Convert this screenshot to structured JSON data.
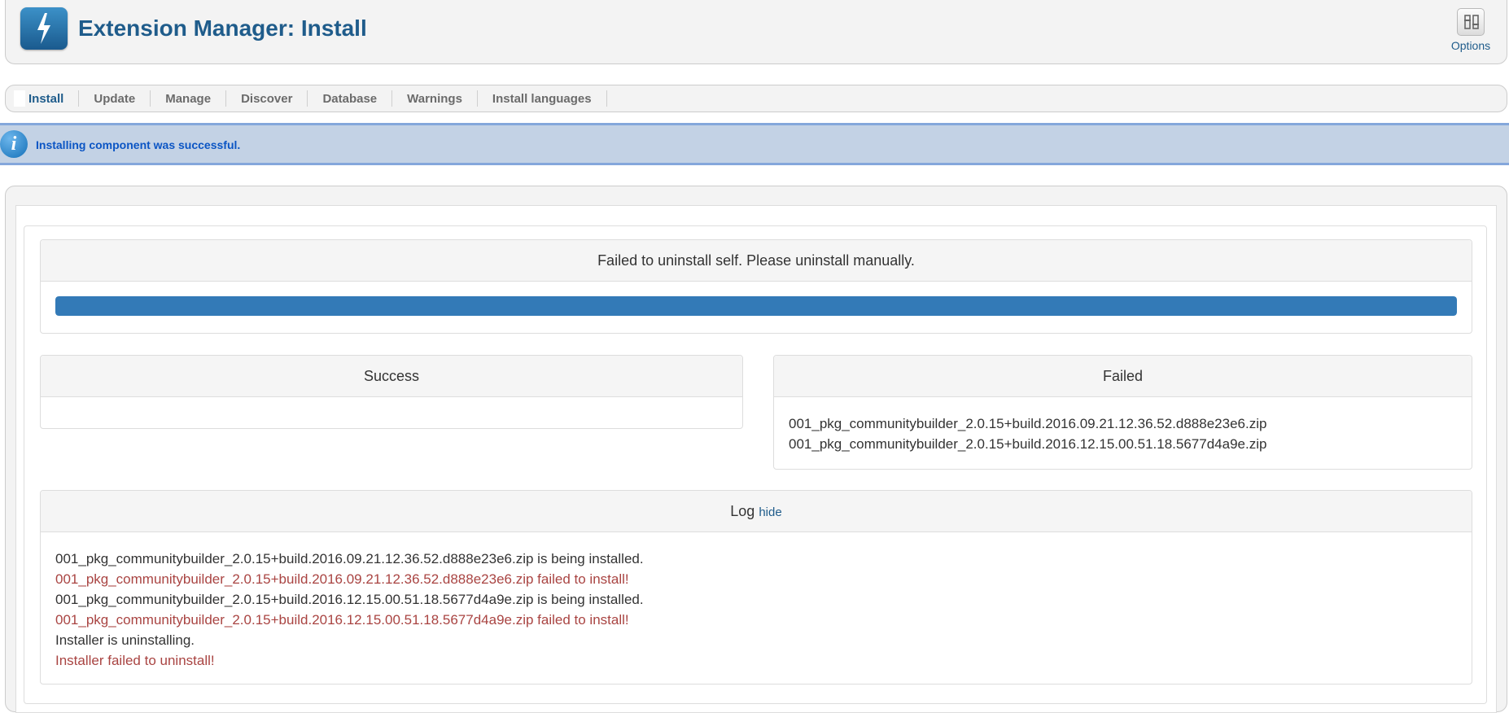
{
  "header": {
    "title": "Extension Manager: Install",
    "options_label": "Options"
  },
  "subnav": {
    "items": [
      "Install",
      "Update",
      "Manage",
      "Discover",
      "Database",
      "Warnings",
      "Install languages"
    ],
    "active": "Install"
  },
  "message": {
    "text": "Installing component was successful."
  },
  "status_panel": {
    "heading": "Failed to uninstall self. Please uninstall manually.",
    "progress": 1.0
  },
  "success_panel": {
    "heading": "Success",
    "items": []
  },
  "failed_panel": {
    "heading": "Failed",
    "items": [
      "001_pkg_communitybuilder_2.0.15+build.2016.09.21.12.36.52.d888e23e6.zip",
      "001_pkg_communitybuilder_2.0.15+build.2016.12.15.00.51.18.5677d4a9e.zip"
    ]
  },
  "log_panel": {
    "heading": "Log",
    "hide_label": "hide",
    "lines": [
      {
        "text": "001_pkg_communitybuilder_2.0.15+build.2016.09.21.12.36.52.d888e23e6.zip is being installed.",
        "status": "info"
      },
      {
        "text": "001_pkg_communitybuilder_2.0.15+build.2016.09.21.12.36.52.d888e23e6.zip failed to install!",
        "status": "error"
      },
      {
        "text": "001_pkg_communitybuilder_2.0.15+build.2016.12.15.00.51.18.5677d4a9e.zip is being installed.",
        "status": "info"
      },
      {
        "text": "001_pkg_communitybuilder_2.0.15+build.2016.12.15.00.51.18.5677d4a9e.zip failed to install!",
        "status": "error"
      },
      {
        "text": "Installer is uninstalling.",
        "status": "info"
      },
      {
        "text": "Installer failed to uninstall!",
        "status": "error"
      }
    ]
  },
  "colors": {
    "title": "#1f5c8b",
    "progress": "#337ab7",
    "error_text": "#a94442",
    "message_bg": "#c3d2e5"
  }
}
